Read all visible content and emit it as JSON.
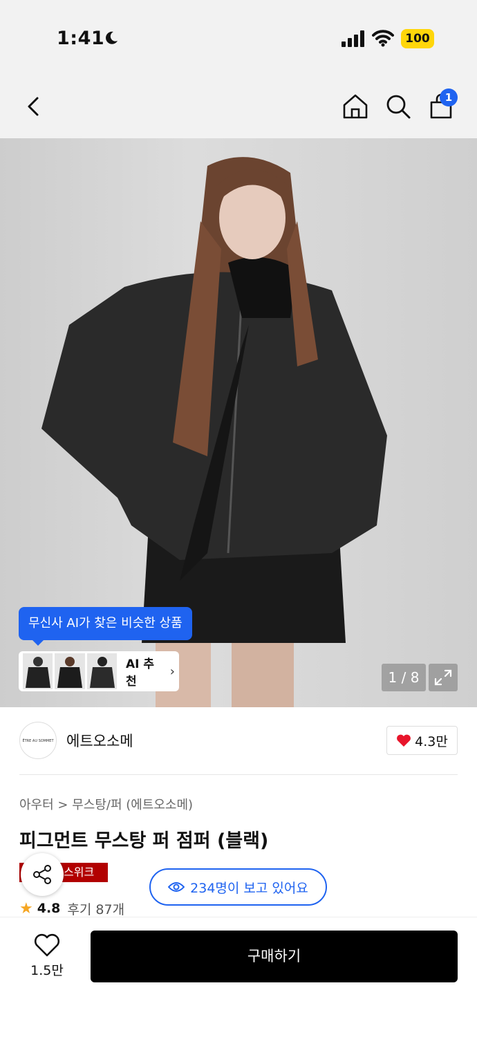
{
  "status_bar": {
    "time": "1:41",
    "battery": "100"
  },
  "nav": {
    "cart_count": "1"
  },
  "product_image": {
    "ai_tooltip": "무신사 AI가 찾은 비슷한 상품",
    "ai_recommend_label": "AI 추천",
    "page_indicator": "1 / 8"
  },
  "brand": {
    "name": "에트오소메",
    "logo_text": "ÊTRE AU SOMMET",
    "likes": "4.3만"
  },
  "product": {
    "breadcrumb": "아우터 > 무스탕/퍼 (에트오소메)",
    "title": "피그먼트 무스탕 퍼 점퍼 (블랙)",
    "badge": "스위크",
    "viewers": "234명이 보고 있어요",
    "rating": "4.8",
    "reviews": "후기 87개"
  },
  "bottom_bar": {
    "wish_count": "1.5만",
    "buy_label": "구매하기"
  },
  "colors": {
    "accent": "#1f63f0",
    "heart": "#e8152b",
    "badge": "#b20000"
  }
}
